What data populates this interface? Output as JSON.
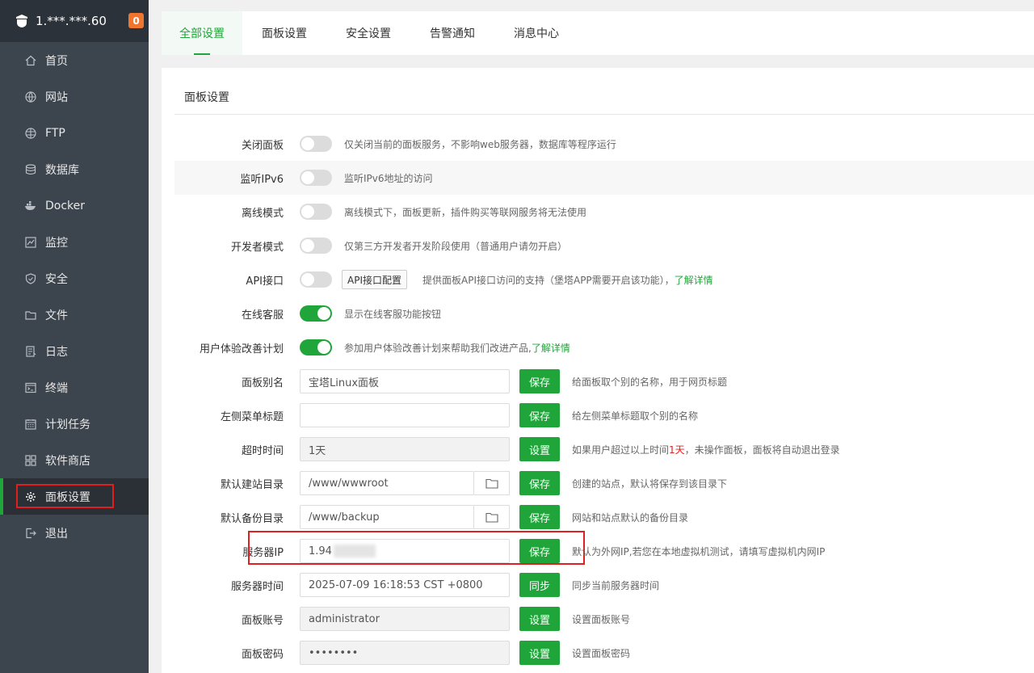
{
  "sidebar": {
    "server": "1.***.***.60",
    "badge": "0",
    "items": [
      {
        "label": "首页",
        "icon": "home-icon"
      },
      {
        "label": "网站",
        "icon": "globe-icon"
      },
      {
        "label": "FTP",
        "icon": "ftp-globe-icon"
      },
      {
        "label": "数据库",
        "icon": "database-icon"
      },
      {
        "label": "Docker",
        "icon": "docker-icon"
      },
      {
        "label": "监控",
        "icon": "monitor-chart-icon"
      },
      {
        "label": "安全",
        "icon": "shield-icon"
      },
      {
        "label": "文件",
        "icon": "folder-icon"
      },
      {
        "label": "日志",
        "icon": "log-icon"
      },
      {
        "label": "终端",
        "icon": "terminal-icon"
      },
      {
        "label": "计划任务",
        "icon": "calendar-icon"
      },
      {
        "label": "软件商店",
        "icon": "grid-icon"
      },
      {
        "label": "面板设置",
        "icon": "gear-icon"
      },
      {
        "label": "退出",
        "icon": "logout-icon"
      }
    ]
  },
  "tabs": [
    "全部设置",
    "面板设置",
    "安全设置",
    "告警通知",
    "消息中心"
  ],
  "panel": {
    "title": "面板设置",
    "close_panel": {
      "label": "关闭面板",
      "desc": "仅关闭当前的面板服务，不影响web服务器，数据库等程序运行"
    },
    "ipv6": {
      "label": "监听IPv6",
      "desc": "监听IPv6地址的访问"
    },
    "offline": {
      "label": "离线模式",
      "desc": "离线模式下，面板更新，插件购买等联网服务将无法使用"
    },
    "dev": {
      "label": "开发者模式",
      "desc": "仅第三方开发者开发阶段使用（普通用户请勿开启）"
    },
    "api": {
      "label": "API接口",
      "config_btn": "API接口配置",
      "desc": "提供面板API接口访问的支持（堡塔APP需要开启该功能），",
      "link": "了解详情"
    },
    "support": {
      "label": "在线客服",
      "desc": "显示在线客服功能按钮"
    },
    "ux": {
      "label": "用户体验改善计划",
      "desc": "参加用户体验改善计划来帮助我们改进产品,",
      "link": "了解详情"
    },
    "alias": {
      "label": "面板别名",
      "value": "宝塔Linux面板",
      "btn": "保存",
      "desc": "给面板取个别的名称，用于网页标题"
    },
    "menu_title": {
      "label": "左侧菜单标题",
      "value": "",
      "btn": "保存",
      "desc": "给左侧菜单标题取个别的名称"
    },
    "timeout": {
      "label": "超时时间",
      "value": "1天",
      "btn": "设置",
      "desc_a": "如果用户超过以上时间",
      "desc_red": "1天",
      "desc_b": "，未操作面板，面板将自动退出登录"
    },
    "site_dir": {
      "label": "默认建站目录",
      "value": "/www/wwwroot",
      "btn": "保存",
      "desc": "创建的站点，默认将保存到该目录下"
    },
    "backup_dir": {
      "label": "默认备份目录",
      "value": "/www/backup",
      "btn": "保存",
      "desc": "网站和站点默认的备份目录"
    },
    "server_ip": {
      "label": "服务器IP",
      "value": "1.94",
      "btn": "保存",
      "desc": "默认为外网IP,若您在本地虚拟机测试，请填写虚拟机内网IP"
    },
    "server_time": {
      "label": "服务器时间",
      "value": "2025-07-09 16:18:53 CST +0800",
      "btn": "同步",
      "desc": "同步当前服务器时间"
    },
    "account": {
      "label": "面板账号",
      "value": "administrator",
      "btn": "设置",
      "desc": "设置面板账号"
    },
    "password": {
      "label": "面板密码",
      "value": "••••••••",
      "btn": "设置",
      "desc": "设置面板密码"
    }
  },
  "colors": {
    "accent": "#20a53a",
    "sidebar_bg": "#3c444d",
    "highlight": "#e02020",
    "badge": "#f0752e"
  }
}
